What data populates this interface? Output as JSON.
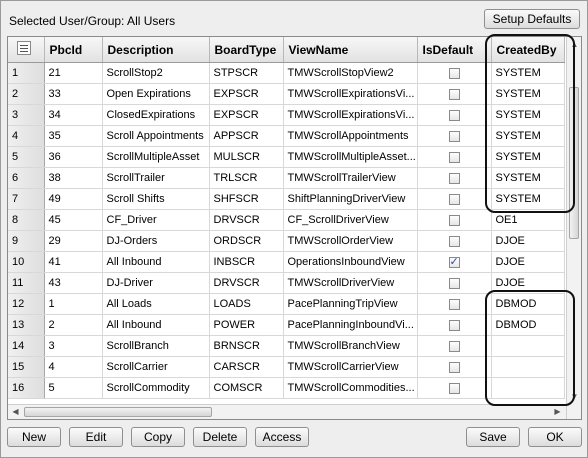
{
  "header": {
    "selected_label": "Selected User/Group:  All Users"
  },
  "buttons": {
    "setup_defaults": "Setup Defaults",
    "new": "New",
    "edit": "Edit",
    "copy": "Copy",
    "delete": "Delete",
    "access": "Access",
    "save": "Save",
    "ok": "OK"
  },
  "table": {
    "columns": [
      "PbcId",
      "Description",
      "BoardType",
      "ViewName",
      "IsDefault",
      "CreatedBy"
    ],
    "rows": [
      {
        "num": "1",
        "pbcid": "21",
        "desc": "ScrollStop2",
        "board": "STPSCR",
        "view": "TMWScrollStopView2",
        "is_default": false,
        "created": "SYSTEM"
      },
      {
        "num": "2",
        "pbcid": "33",
        "desc": "Open Expirations",
        "board": "EXPSCR",
        "view": "TMWScrollExpirationsVi...",
        "is_default": false,
        "created": "SYSTEM"
      },
      {
        "num": "3",
        "pbcid": "34",
        "desc": "ClosedExpirations",
        "board": "EXPSCR",
        "view": "TMWScrollExpirationsVi...",
        "is_default": false,
        "created": "SYSTEM"
      },
      {
        "num": "4",
        "pbcid": "35",
        "desc": "Scroll Appointments",
        "board": "APPSCR",
        "view": "TMWScrollAppointments",
        "is_default": false,
        "created": "SYSTEM"
      },
      {
        "num": "5",
        "pbcid": "36",
        "desc": "ScrollMultipleAsset",
        "board": "MULSCR",
        "view": "TMWScrollMultipleAsset...",
        "is_default": false,
        "created": "SYSTEM"
      },
      {
        "num": "6",
        "pbcid": "38",
        "desc": "ScrollTrailer",
        "board": "TRLSCR",
        "view": "TMWScrollTrailerView",
        "is_default": false,
        "created": "SYSTEM"
      },
      {
        "num": "7",
        "pbcid": "49",
        "desc": "Scroll Shifts",
        "board": "SHFSCR",
        "view": "ShiftPlanningDriverView",
        "is_default": false,
        "created": "SYSTEM"
      },
      {
        "num": "8",
        "pbcid": "45",
        "desc": "CF_Driver",
        "board": "DRVSCR",
        "view": "CF_ScrollDriverView",
        "is_default": false,
        "created": "OE1"
      },
      {
        "num": "9",
        "pbcid": "29",
        "desc": "DJ-Orders",
        "board": "ORDSCR",
        "view": "TMWScrollOrderView",
        "is_default": false,
        "created": "DJOE"
      },
      {
        "num": "10",
        "pbcid": "41",
        "desc": "All Inbound",
        "board": "INBSCR",
        "view": "OperationsInboundView",
        "is_default": true,
        "created": "DJOE"
      },
      {
        "num": "11",
        "pbcid": "43",
        "desc": "DJ-Driver",
        "board": "DRVSCR",
        "view": "TMWScrollDriverView",
        "is_default": false,
        "created": "DJOE"
      },
      {
        "num": "12",
        "pbcid": "1",
        "desc": "All Loads",
        "board": "LOADS",
        "view": "PacePlanningTripView",
        "is_default": false,
        "created": "DBMOD"
      },
      {
        "num": "13",
        "pbcid": "2",
        "desc": "All Inbound",
        "board": "POWER",
        "view": "PacePlanningInboundVi...",
        "is_default": false,
        "created": "DBMOD"
      },
      {
        "num": "14",
        "pbcid": "3",
        "desc": "ScrollBranch",
        "board": "BRNSCR",
        "view": "TMWScrollBranchView",
        "is_default": false,
        "created": ""
      },
      {
        "num": "15",
        "pbcid": "4",
        "desc": "ScrollCarrier",
        "board": "CARSCR",
        "view": "TMWScrollCarrierView",
        "is_default": false,
        "created": ""
      },
      {
        "num": "16",
        "pbcid": "5",
        "desc": "ScrollCommodity",
        "board": "COMSCR",
        "view": "TMWScrollCommodities...",
        "is_default": false,
        "created": ""
      }
    ]
  },
  "icons": {
    "corner": "column-chooser-icon",
    "scroll_up": "arrow-up-icon",
    "scroll_down": "arrow-down-icon",
    "scroll_left": "arrow-left-icon",
    "scroll_right": "arrow-right-icon"
  },
  "colors": {
    "highlight": "#111111",
    "check": "#2a4aa8"
  }
}
